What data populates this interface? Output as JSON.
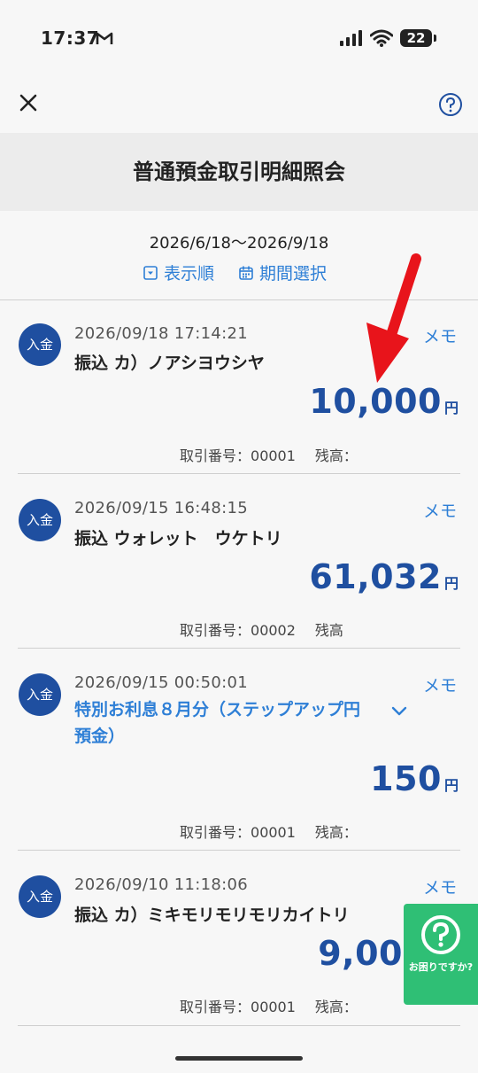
{
  "status_bar": {
    "time": "17:37",
    "battery": "22"
  },
  "header": {
    "title": "普通預金取引明細照会"
  },
  "period": {
    "range": "2026/6/18〜2026/9/18",
    "sort_label": "表示順",
    "period_label": "期間選択"
  },
  "transactions": [
    {
      "type": "入金",
      "datetime": "2026/09/18 17:14:21",
      "description": "振込 カ）ノアシヨウシヤ",
      "memo": "メモ",
      "amount": "10,000",
      "currency": "円",
      "ref_label": "取引番号：",
      "ref": "00001",
      "balance_label": "残高："
    },
    {
      "type": "入金",
      "datetime": "2026/09/15 16:48:15",
      "description": "振込 ウォレット　ウケトリ",
      "memo": "メモ",
      "amount": "61,032",
      "currency": "円",
      "ref_label": "取引番号：",
      "ref": "00002",
      "balance_label": "残高"
    },
    {
      "type": "入金",
      "datetime": "2026/09/15 00:50:01",
      "description": "特別お利息８月分（ステップアップ円預金）",
      "memo": "メモ",
      "amount": "150",
      "currency": "円",
      "ref_label": "取引番号：",
      "ref": "00001",
      "balance_label": "残高："
    },
    {
      "type": "入金",
      "datetime": "2026/09/10 11:18:06",
      "description": "振込 カ）ミキモリモリモリカイトリ",
      "memo": "メモ",
      "amount": "9,00",
      "currency": "",
      "ref_label": "取引番号：",
      "ref": "00001",
      "balance_label": "残高："
    }
  ],
  "help_widget": {
    "label": "お困りですか?"
  },
  "colors": {
    "accent": "#2e7fd6",
    "badge": "#1f4fa0",
    "amount": "#1f4fa0",
    "help": "#2fbf75",
    "annotation_arrow": "#e8141b"
  }
}
